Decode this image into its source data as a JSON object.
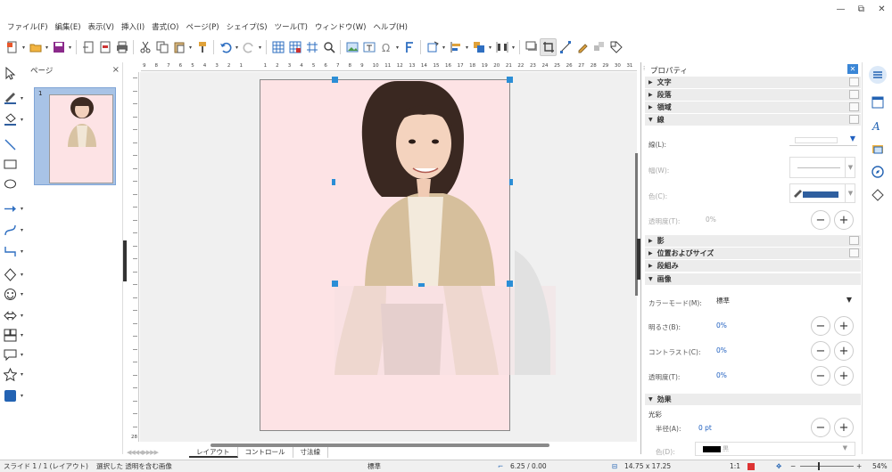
{
  "menu": [
    "ファイル(F)",
    "編集(E)",
    "表示(V)",
    "挿入(I)",
    "書式(O)",
    "ページ(P)",
    "シェイプ(S)",
    "ツール(T)",
    "ウィンドウ(W)",
    "ヘルプ(H)"
  ],
  "window_controls": [
    "—",
    "⧉",
    "✕"
  ],
  "slide_pane": {
    "title": "ページ",
    "close": "×",
    "thumb_number": "1"
  },
  "ruler_ticks": [
    "9",
    "8",
    "7",
    "6",
    "5",
    "4",
    "3",
    "2",
    "1",
    "",
    "1",
    "2",
    "3",
    "4",
    "5",
    "6",
    "7",
    "8",
    "9",
    "10",
    "11",
    "12",
    "13",
    "14",
    "15",
    "16",
    "17",
    "18",
    "19",
    "20",
    "21",
    "22",
    "23",
    "24",
    "25",
    "26",
    "27",
    "28",
    "29",
    "30",
    "31"
  ],
  "vruler_bottom": "28",
  "tabs": {
    "nav": "◀◀◀◀▶▶▶▶",
    "items": [
      "レイアウト",
      "コントロール",
      "寸法線"
    ],
    "active": 0
  },
  "sidebar": {
    "title": "プロパティ",
    "close": "✕",
    "sections": {
      "text": "文字",
      "paragraph": "段落",
      "area": "領域",
      "line": "線",
      "shadow": "影",
      "position": "位置およびサイズ",
      "columns": "段組み",
      "image": "画像",
      "effect": "効果"
    },
    "line": {
      "line_label": "線(L):",
      "width_label": "幅(W):",
      "color_label": "色(C):",
      "transparency_label": "透明度(T):",
      "transparency_value": "0%"
    },
    "image": {
      "color_mode_label": "カラーモード(M):",
      "color_mode_value": "標準",
      "brightness_label": "明るさ(B):",
      "brightness_value": "0%",
      "contrast_label": "コントラスト(C):",
      "contrast_value": "0%",
      "transparency_label": "透明度(T):",
      "transparency_value": "0%"
    },
    "effect": {
      "glow_label": "光彩",
      "radius_label": "半径(A):",
      "radius_value": "0 pt",
      "color_label": "色(D):",
      "color_value": "黒"
    },
    "minus": "−",
    "plus": "+"
  },
  "status": {
    "slide": "スライド 1 / 1 (レイアウト)",
    "selection": "選択した 透明を含む画像",
    "style": "標準",
    "position": "6.25 / 0.00",
    "size": "14.75 x 17.25",
    "scale": "1:1",
    "zoom_minus": "−",
    "zoom_plus": "+",
    "zoom": "54%",
    "zoom_level": 0.54
  },
  "colors": {
    "page_bg": "#fde3e5",
    "handle": "#2b8ed6",
    "line_color": "#2f5f9f",
    "accent": "#2060c0"
  }
}
